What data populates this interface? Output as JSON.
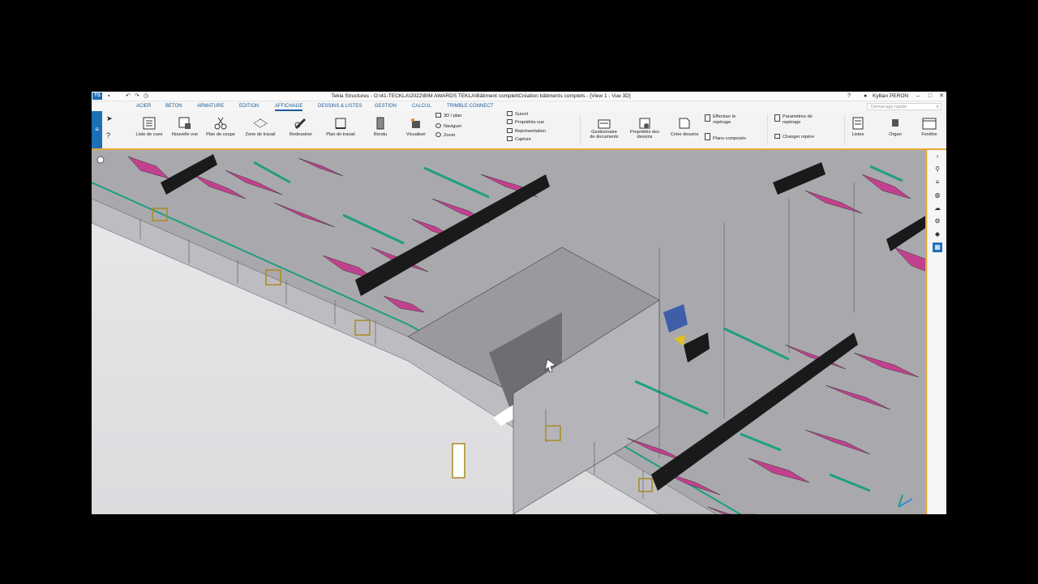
{
  "window": {
    "title": "Tekla Structures - O:\\41-TECKLA\\2022\\BIM AWARDS TEKLA\\Bâtiment complet\\Création bâtiments complets - [View 1 - Vue 3D]",
    "user": "Kyllian PERON",
    "logo_text": "TS"
  },
  "tabs": [
    "ACIER",
    "BÉTON",
    "ARMATURE",
    "EDITION",
    "AFFICHAGE",
    "DESSINS & LISTES",
    "GESTION",
    "CALCUL",
    "TRIMBLE CONNECT"
  ],
  "active_tab": "AFFICHAGE",
  "search": {
    "placeholder": "Démarrage rapide"
  },
  "ribbon": {
    "liste_vues": "Liste de vues",
    "nouvelle_vue": "Nouvelle vue",
    "plan_coupe": "Plan de coupe",
    "zone_travail": "Zone de travail",
    "redessiner": "Redessiner",
    "plan_travail": "Plan de travail",
    "rendu": "Rendu",
    "visualiser": "Visualiser",
    "vue_3d_plan": "3D / plan",
    "naviguer": "Naviguer",
    "zoom": "Zoom",
    "survol": "Survol",
    "proprietes_vue": "Propriétés vue",
    "representation": "Représentation",
    "capture": "Capture",
    "gestionnaire_docs_1": "Gestionnaire",
    "gestionnaire_docs_2": "de documents",
    "proprietes_dessins_1": "Propriétés des",
    "proprietes_dessins_2": "dessins",
    "creer_dessins": "Créer dessins",
    "effectuer_reperage_1": "Effectuer le",
    "effectuer_reperage_2": "repérage",
    "plans_composes": "Plans composés",
    "parametres_reperage_1": "Paramètres de",
    "parametres_reperage_2": "repérage",
    "changer_repere": "Changer repère",
    "listes": "Listes",
    "organ": "Organ",
    "fenetre": "Fenêtre"
  },
  "colors": {
    "accent": "#1d6fb8",
    "ribbon_border": "#e4a935",
    "wall": "#c9c9cc",
    "floor_magenta": "#c2418f",
    "beam_teal": "#1f9e82"
  }
}
